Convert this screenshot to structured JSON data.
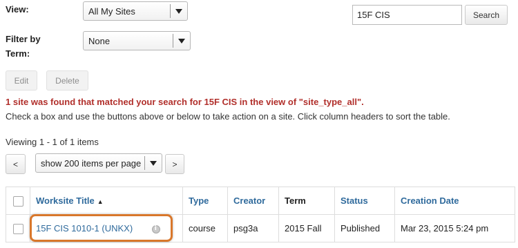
{
  "filters": {
    "view_label": "View:",
    "view_value": "All My Sites",
    "filter_label_line1": "Filter by",
    "filter_label_line2": "Term:",
    "filter_value": "None"
  },
  "search": {
    "value": "15F CIS",
    "button_label": "Search"
  },
  "actions": {
    "edit_label": "Edit",
    "delete_label": "Delete"
  },
  "messages": {
    "alert": "1 site was found that matched your search for 15F CIS in the view of \"site_type_all\".",
    "instructions": "Check a box and use the buttons above or below to take action on a site. Click column headers to sort the table."
  },
  "pager": {
    "viewing_text": "Viewing 1 - 1 of 1 items",
    "prev_label": "<",
    "page_size_value": "show 200 items per page",
    "next_label": ">"
  },
  "table": {
    "headers": {
      "title": "Worksite Title",
      "type": "Type",
      "creator": "Creator",
      "term": "Term",
      "status": "Status",
      "creation_date": "Creation Date"
    },
    "rows": [
      {
        "title": "15F CIS 1010-1 (UNKX)",
        "type": "course",
        "creator": "psg3a",
        "term": "2015 Fall",
        "status": "Published",
        "creation_date": "Mar 23, 2015 5:24 pm"
      }
    ]
  },
  "colors": {
    "link": "#2f6a9c",
    "alert": "#b12f2b",
    "highlight": "#d9772b"
  }
}
